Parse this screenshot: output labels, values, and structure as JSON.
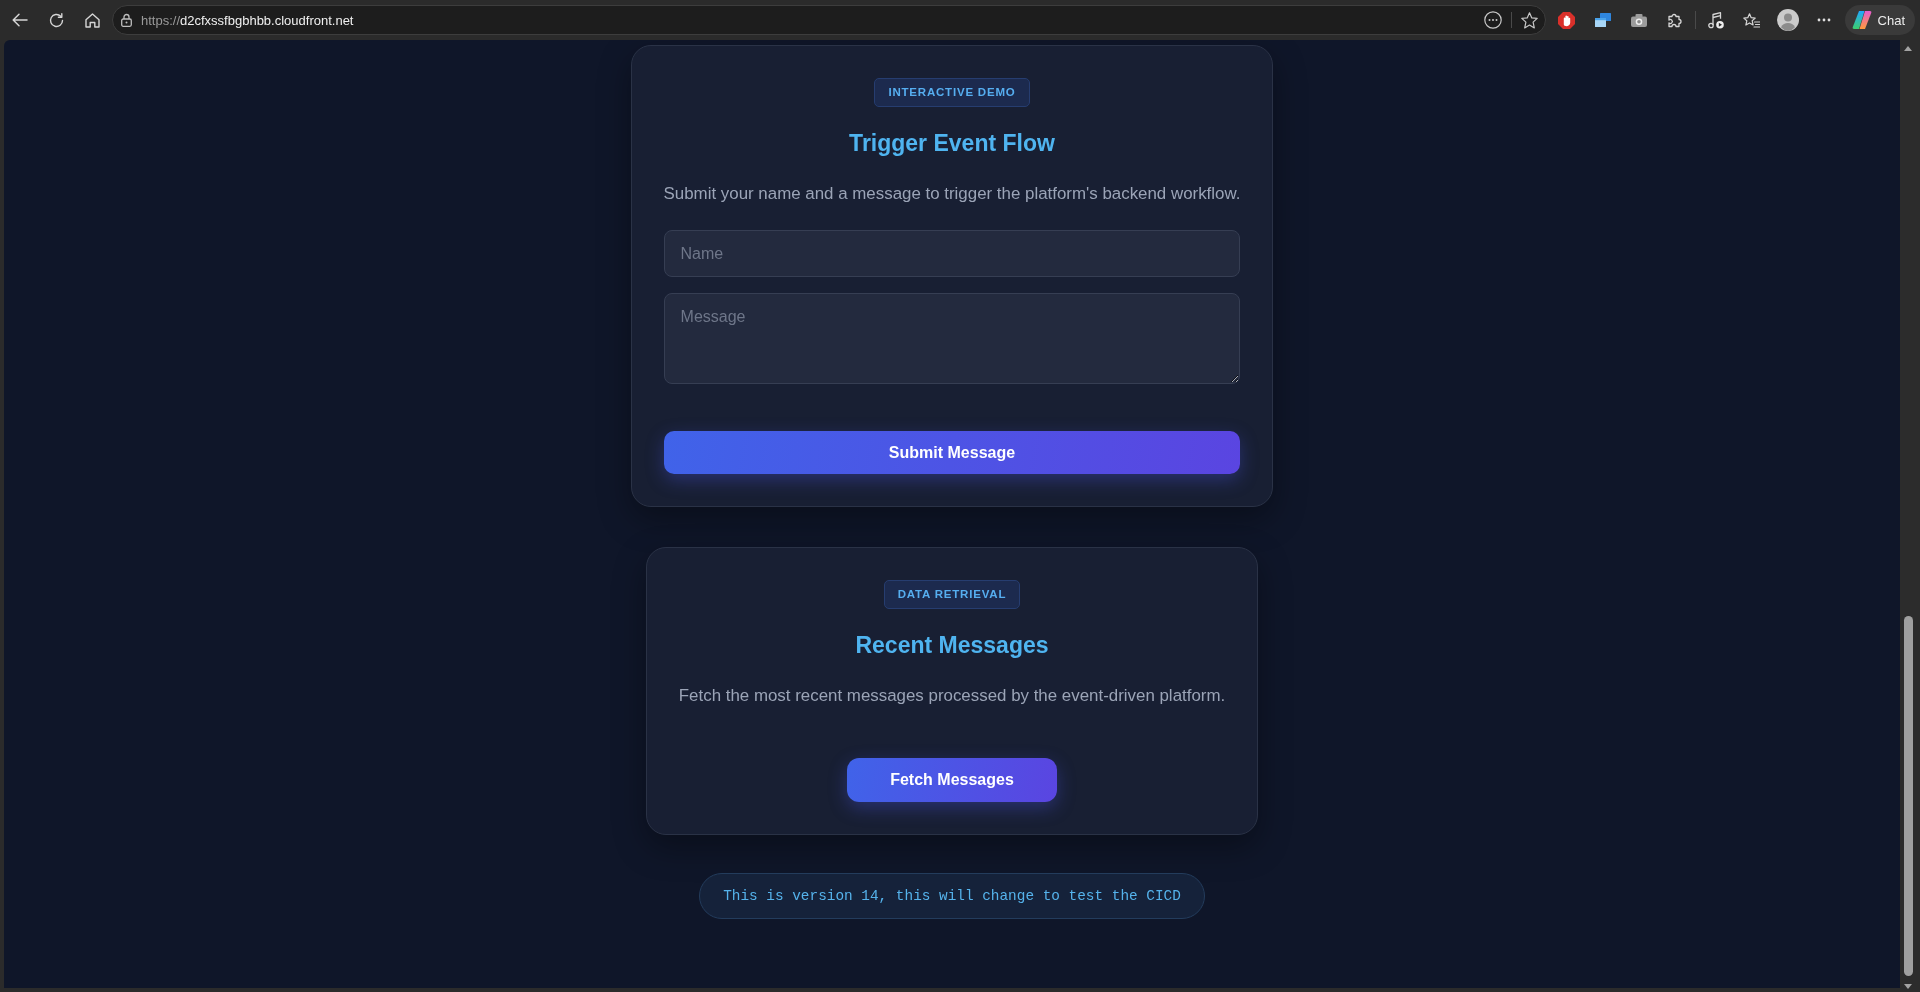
{
  "browser": {
    "address_bar": {
      "scheme": "https://",
      "host": "d2cfxssfbgbhbb.cloudfront.net"
    },
    "chat_button": {
      "label": "Chat"
    }
  },
  "cards": [
    {
      "kind": "form",
      "badge": "INTERACTIVE DEMO",
      "title": "Trigger Event Flow",
      "description": "Submit your name and a message to trigger the platform's backend workflow.",
      "fields": [
        {
          "kind": "input",
          "placeholder": "Name"
        },
        {
          "kind": "textarea",
          "placeholder": "Message"
        }
      ],
      "button": {
        "label": "Submit Message"
      }
    },
    {
      "kind": "action",
      "badge": "DATA RETRIEVAL",
      "title": "Recent Messages",
      "description": "Fetch the most recent messages processed by the event-driven platform.",
      "button": {
        "label": "Fetch Messages"
      }
    }
  ],
  "version_note": "This is version 14, this will change to test the CICD"
}
